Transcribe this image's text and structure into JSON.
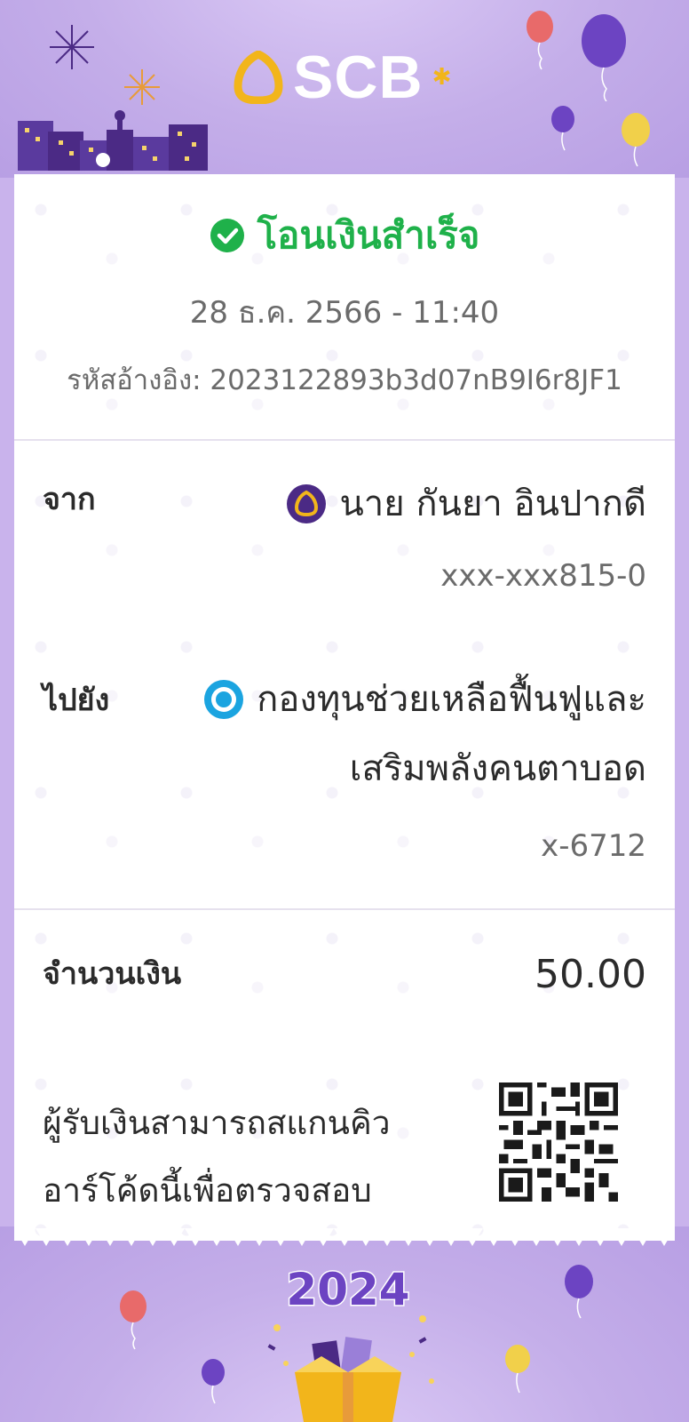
{
  "brand": {
    "name": "SCB"
  },
  "receipt": {
    "status": "โอนเงินสำเร็จ",
    "datetime": "28 ธ.ค. 2566 - 11:40",
    "reference": "รหัสอ้างอิง: 2023122893b3d07nB9I6r8JF1"
  },
  "from": {
    "label": "จาก",
    "name": "นาย กันยา อินปากดี",
    "account": "xxx-xxx815-0",
    "bank_icon": "scb-bank-icon"
  },
  "to": {
    "label": "ไปยัง",
    "name_line1": "กองทุนช่วยเหลือฟื้นฟูและ",
    "name_line2": "เสริมพลังคนตาบอด",
    "account": "x-6712",
    "bank_icon": "krungthai-bank-icon"
  },
  "amount": {
    "label": "จำนวนเงิน",
    "value": "50.00"
  },
  "verify": {
    "line1": "ผู้รับเงินสามารถสแกนคิว",
    "line2": "อาร์โค้ดนี้เพื่อตรวจสอบ",
    "qr_icon": "qr-code-icon"
  },
  "banner": {
    "year": "2024"
  },
  "colors": {
    "success": "#1fb14a",
    "brand_purple": "#4b2a85",
    "background": "#c9b3ec",
    "gold": "#f2b51b"
  }
}
